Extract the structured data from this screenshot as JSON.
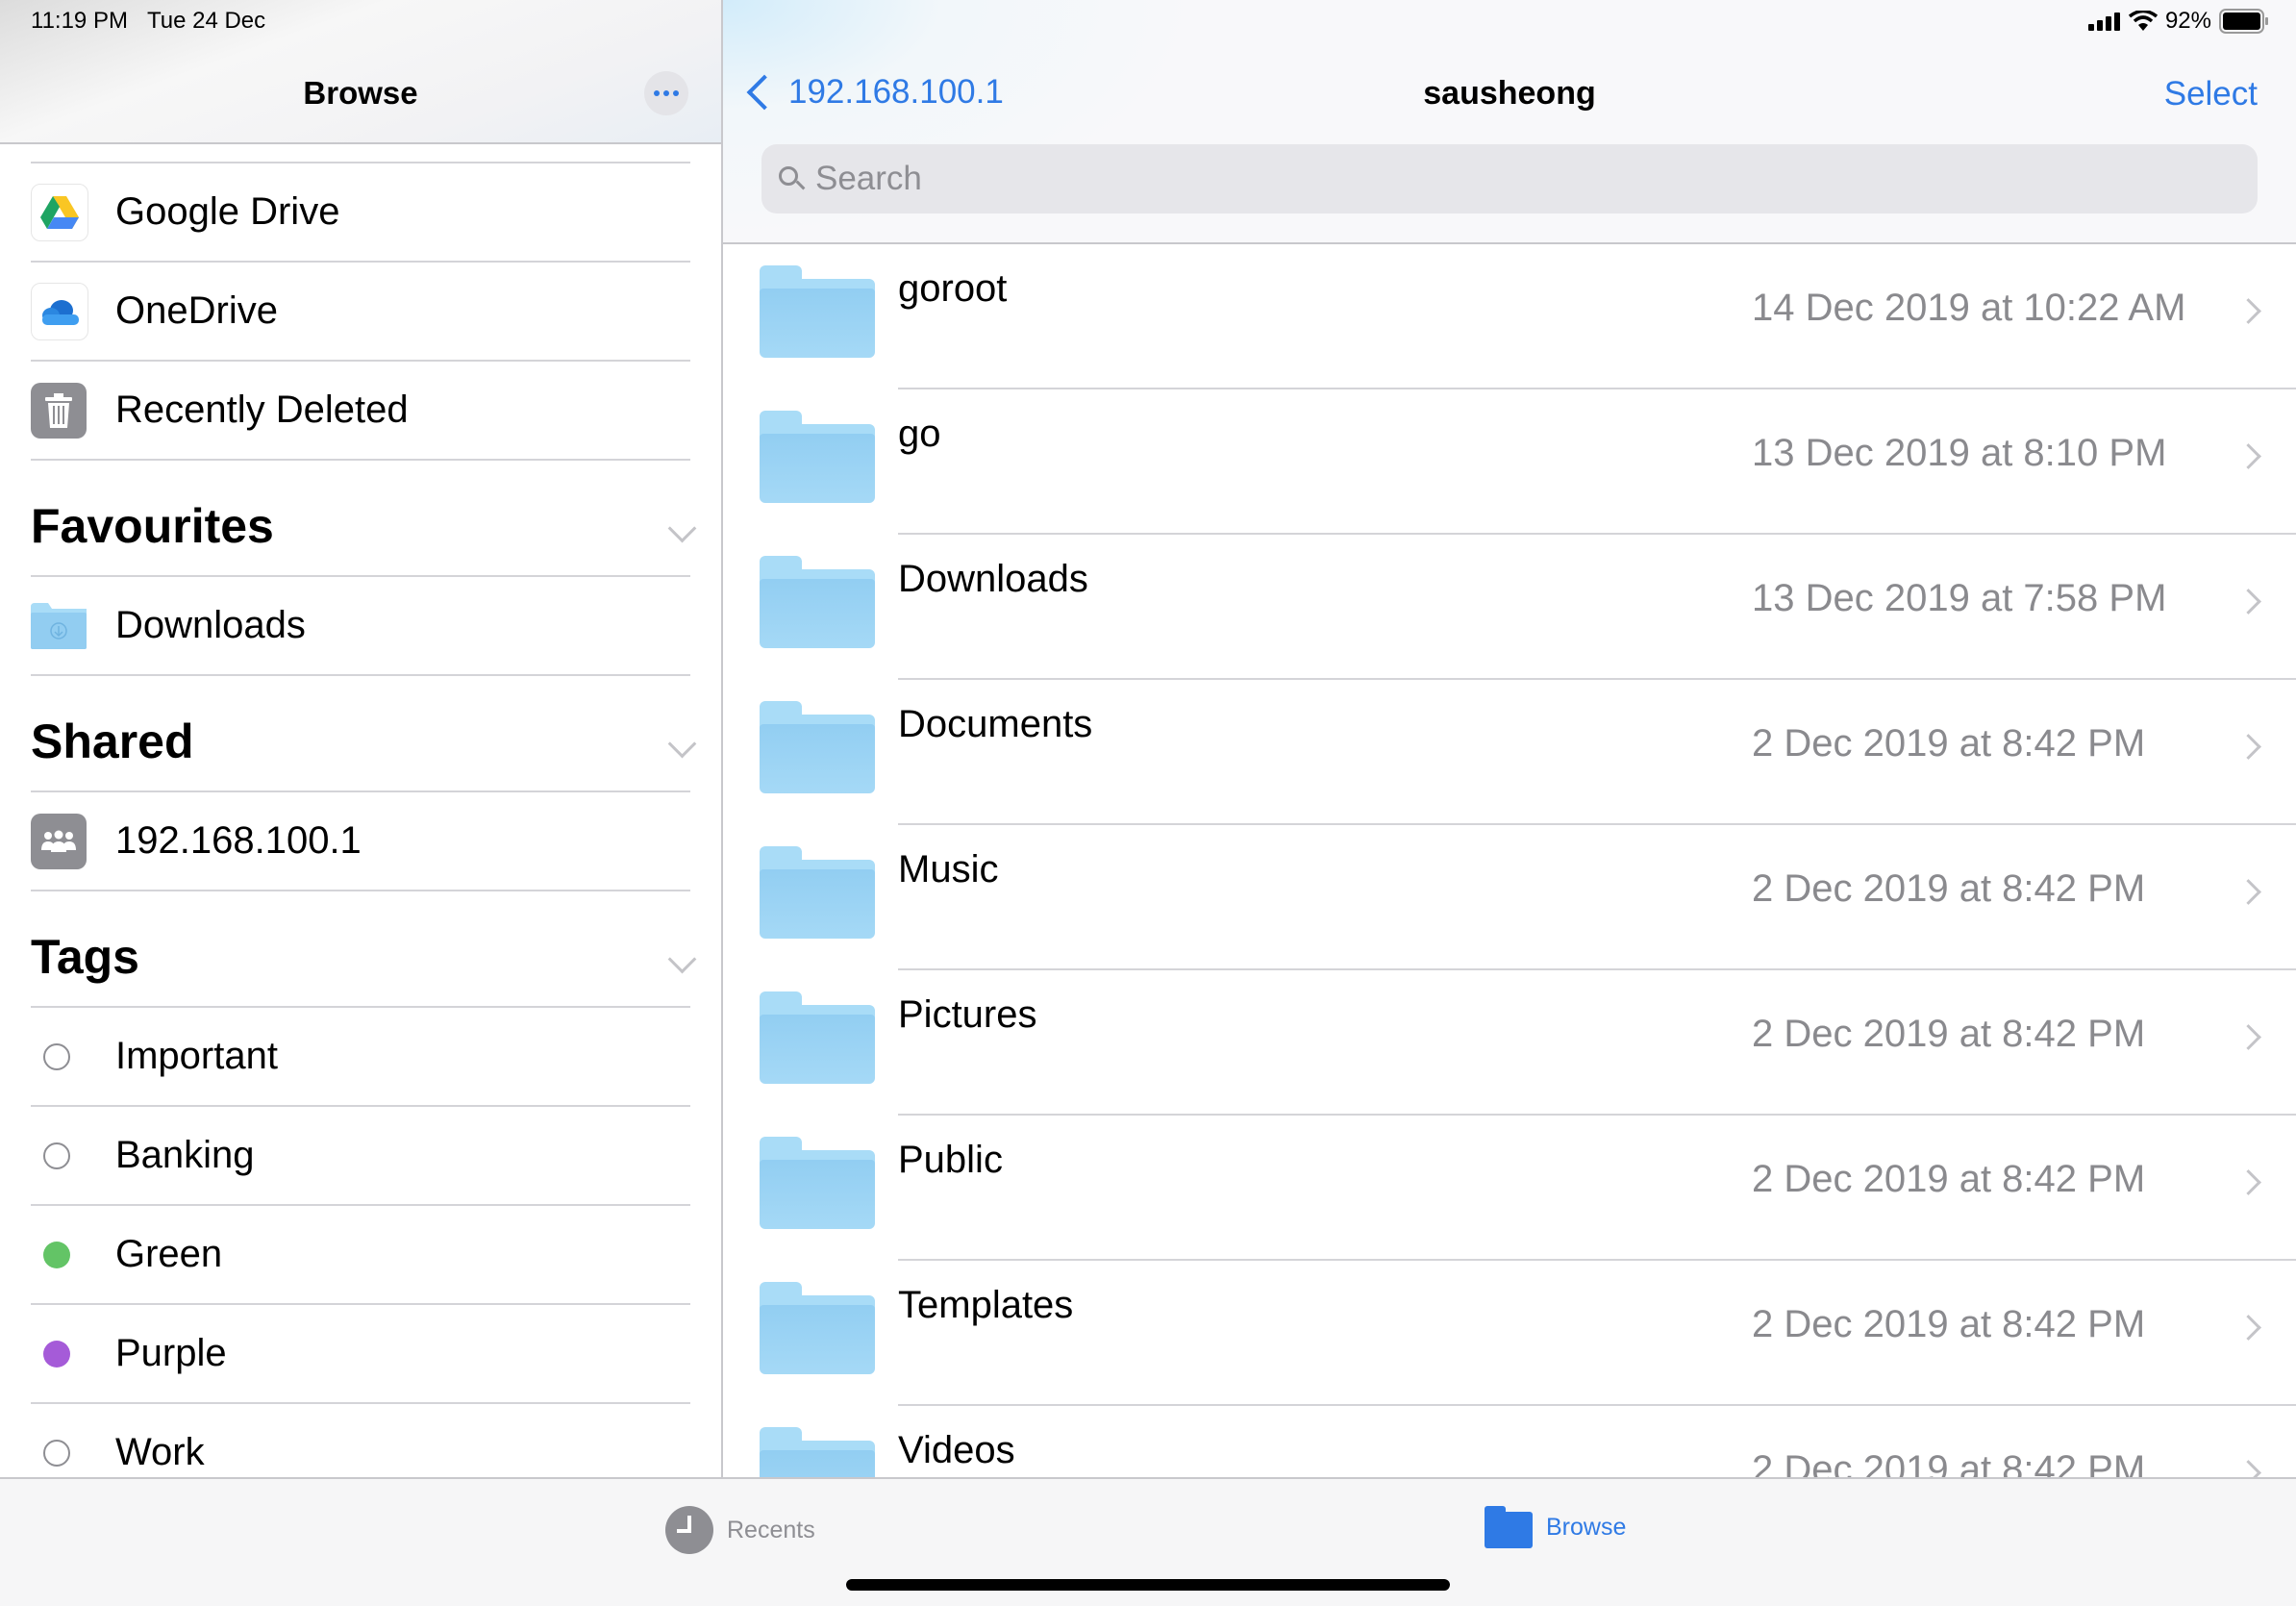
{
  "status_bar": {
    "time": "11:19 PM",
    "date": "Tue 24 Dec",
    "battery": "92%",
    "signal_icon": "cellular-signal-icon",
    "wifi_icon": "wifi-icon",
    "battery_icon": "battery-icon"
  },
  "sidebar": {
    "title": "Browse",
    "more_icon": "ellipsis-icon",
    "locations": [
      {
        "label": "Google Drive",
        "icon": "google-drive-icon"
      },
      {
        "label": "OneDrive",
        "icon": "onedrive-icon"
      },
      {
        "label": "Recently Deleted",
        "icon": "trash-icon"
      }
    ],
    "favourites": {
      "title": "Favourites",
      "items": [
        {
          "label": "Downloads",
          "icon": "downloads-folder-icon"
        }
      ]
    },
    "shared": {
      "title": "Shared",
      "items": [
        {
          "label": "192.168.100.1",
          "icon": "shared-server-icon"
        }
      ]
    },
    "tags": {
      "title": "Tags",
      "items": [
        {
          "label": "Important",
          "color": null
        },
        {
          "label": "Banking",
          "color": null
        },
        {
          "label": "Green",
          "color": "#63c466"
        },
        {
          "label": "Purple",
          "color": "#a55bd8"
        },
        {
          "label": "Work",
          "color": null
        }
      ]
    }
  },
  "main": {
    "back_label": "192.168.100.1",
    "title": "sausheong",
    "select_label": "Select",
    "search_placeholder": "Search",
    "files": [
      {
        "name": "goroot",
        "date": "14 Dec 2019 at 10:22 AM"
      },
      {
        "name": "go",
        "date": "13 Dec 2019 at 8:10 PM"
      },
      {
        "name": "Downloads",
        "date": "13 Dec 2019 at 7:58 PM"
      },
      {
        "name": "Documents",
        "date": "2 Dec 2019 at 8:42 PM"
      },
      {
        "name": "Music",
        "date": "2 Dec 2019 at 8:42 PM"
      },
      {
        "name": "Pictures",
        "date": "2 Dec 2019 at 8:42 PM"
      },
      {
        "name": "Public",
        "date": "2 Dec 2019 at 8:42 PM"
      },
      {
        "name": "Templates",
        "date": "2 Dec 2019 at 8:42 PM"
      },
      {
        "name": "Videos",
        "date": "2 Dec 2019 at 8:42 PM"
      }
    ]
  },
  "tab_bar": {
    "recents_label": "Recents",
    "browse_label": "Browse",
    "active_tab": "Browse",
    "accent_color": "#2f7ae5",
    "inactive_color": "#8e8e93"
  }
}
